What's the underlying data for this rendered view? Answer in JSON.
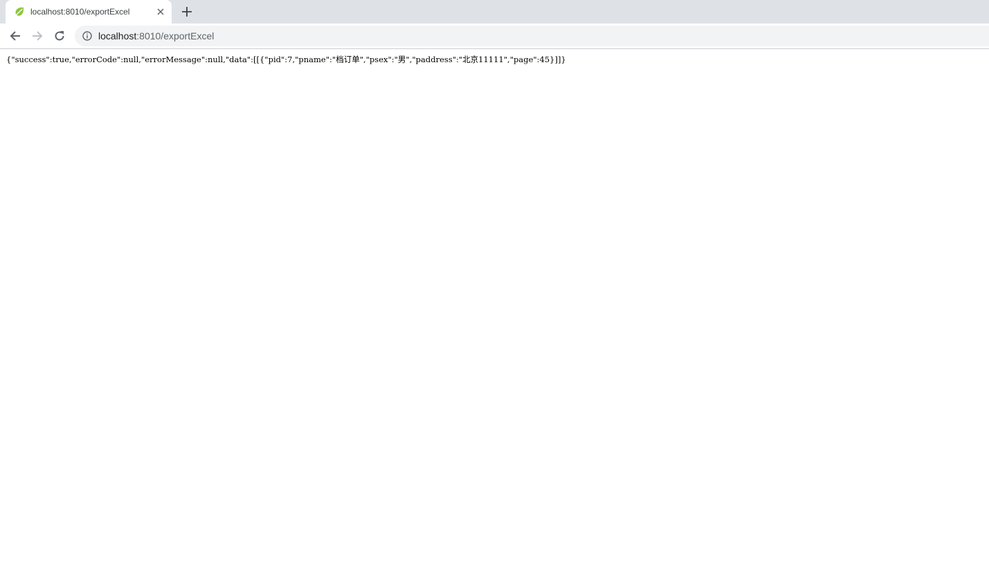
{
  "tab": {
    "title": "localhost:8010/exportExcel",
    "favicon": "spring-leaf-icon"
  },
  "toolbar": {
    "url_host": "localhost",
    "url_path": ":8010/exportExcel",
    "back_icon": "back-arrow-icon",
    "forward_icon": "forward-arrow-icon",
    "reload_icon": "reload-icon",
    "info_icon": "info-icon"
  },
  "page": {
    "body_text": "{\"success\":true,\"errorCode\":null,\"errorMessage\":null,\"data\":[[{\"pid\":7,\"pname\":\"档订单\",\"psex\":\"男\",\"paddress\":\"北京11111\",\"page\":45}]]}"
  },
  "colors": {
    "tabstrip_bg": "#dee1e6",
    "omnibox_bg": "#f1f3f4",
    "favicon_green": "#8dc63f"
  }
}
